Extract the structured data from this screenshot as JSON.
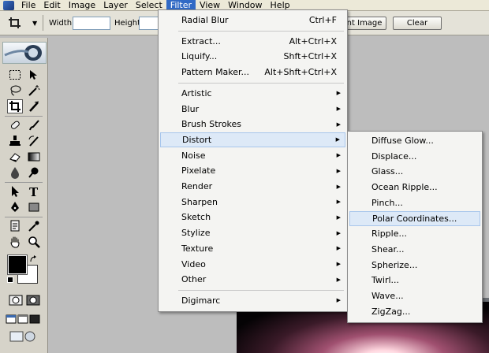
{
  "menubar": {
    "items": [
      "File",
      "Edit",
      "Image",
      "Layer",
      "Select",
      "Filter",
      "View",
      "Window",
      "Help"
    ],
    "active_index": 5
  },
  "options_bar": {
    "width_label": "Width:",
    "height_label": "Height:",
    "front_image_button": "ont Image",
    "clear_button": "Clear"
  },
  "filter_menu": {
    "groups": [
      [
        {
          "label": "Radial Blur",
          "shortcut": "Ctrl+F"
        }
      ],
      [
        {
          "label": "Extract...",
          "shortcut": "Alt+Ctrl+X"
        },
        {
          "label": "Liquify...",
          "shortcut": "Shft+Ctrl+X"
        },
        {
          "label": "Pattern Maker...",
          "shortcut": "Alt+Shft+Ctrl+X"
        }
      ],
      [
        {
          "label": "Artistic",
          "submenu": true
        },
        {
          "label": "Blur",
          "submenu": true
        },
        {
          "label": "Brush Strokes",
          "submenu": true
        },
        {
          "label": "Distort",
          "submenu": true,
          "highlighted": true
        },
        {
          "label": "Noise",
          "submenu": true
        },
        {
          "label": "Pixelate",
          "submenu": true
        },
        {
          "label": "Render",
          "submenu": true
        },
        {
          "label": "Sharpen",
          "submenu": true
        },
        {
          "label": "Sketch",
          "submenu": true
        },
        {
          "label": "Stylize",
          "submenu": true
        },
        {
          "label": "Texture",
          "submenu": true
        },
        {
          "label": "Video",
          "submenu": true
        },
        {
          "label": "Other",
          "submenu": true
        }
      ],
      [
        {
          "label": "Digimarc",
          "submenu": true
        }
      ]
    ]
  },
  "distort_submenu": {
    "items": [
      {
        "label": "Diffuse Glow..."
      },
      {
        "label": "Displace..."
      },
      {
        "label": "Glass..."
      },
      {
        "label": "Ocean Ripple..."
      },
      {
        "label": "Pinch..."
      },
      {
        "label": "Polar Coordinates...",
        "highlighted": true
      },
      {
        "label": "Ripple..."
      },
      {
        "label": "Shear..."
      },
      {
        "label": "Spherize..."
      },
      {
        "label": "Twirl..."
      },
      {
        "label": "Wave..."
      },
      {
        "label": "ZigZag..."
      }
    ]
  },
  "toolbox": {
    "tools": [
      "rectangular-marquee-icon",
      "move-icon",
      "lasso-icon",
      "magic-wand-icon",
      "crop-icon",
      "slice-icon",
      "healing-brush-icon",
      "brush-icon",
      "clone-stamp-icon",
      "history-brush-icon",
      "eraser-icon",
      "gradient-icon",
      "blur-icon",
      "dodge-icon",
      "path-selection-icon",
      "type-icon",
      "pen-icon",
      "shape-icon",
      "notes-icon",
      "eyedropper-icon",
      "hand-icon",
      "zoom-icon"
    ],
    "foreground_color": "#000000",
    "background_color": "#ffffff"
  },
  "colors": {
    "menu_highlight": "#316ac5",
    "item_highlight": "#dde9f7"
  }
}
